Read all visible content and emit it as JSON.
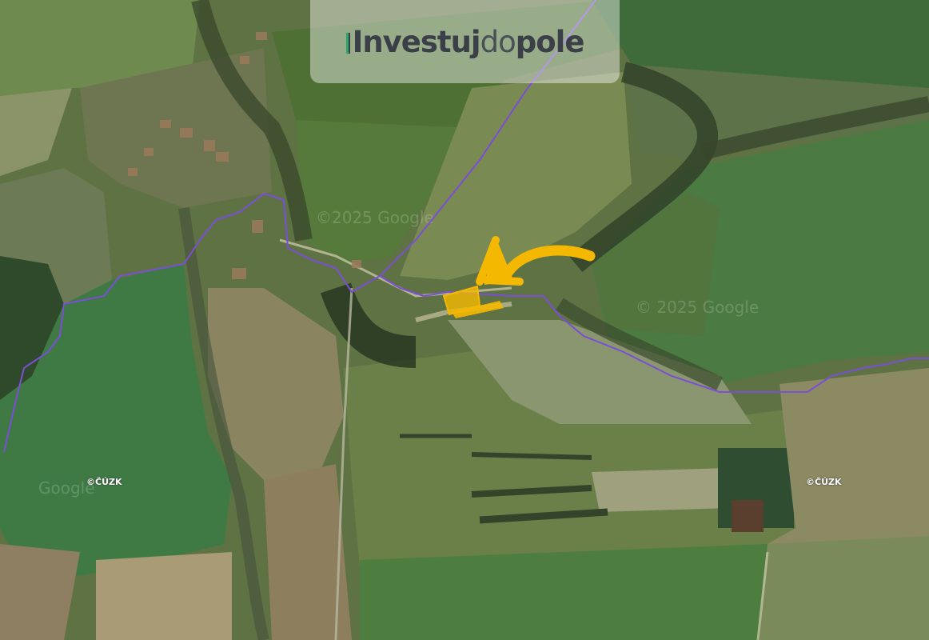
{
  "brand": {
    "part1": "Investuj",
    "part2": "do",
    "part3": "pole",
    "accent_color": "#2fa36b",
    "text_color": "#3b4048"
  },
  "watermarks": {
    "google_1": "©2025 Google",
    "google_2": "© 2025 Google",
    "google_3": "Google"
  },
  "attribution": {
    "cuzk_left": "©ČÚZK",
    "cuzk_right": "©ČÚZK"
  },
  "map": {
    "type": "satellite",
    "boundary_color": "#7a4fd6",
    "parcel_color": "#f5b800",
    "arrow_color": "#f5b800"
  }
}
